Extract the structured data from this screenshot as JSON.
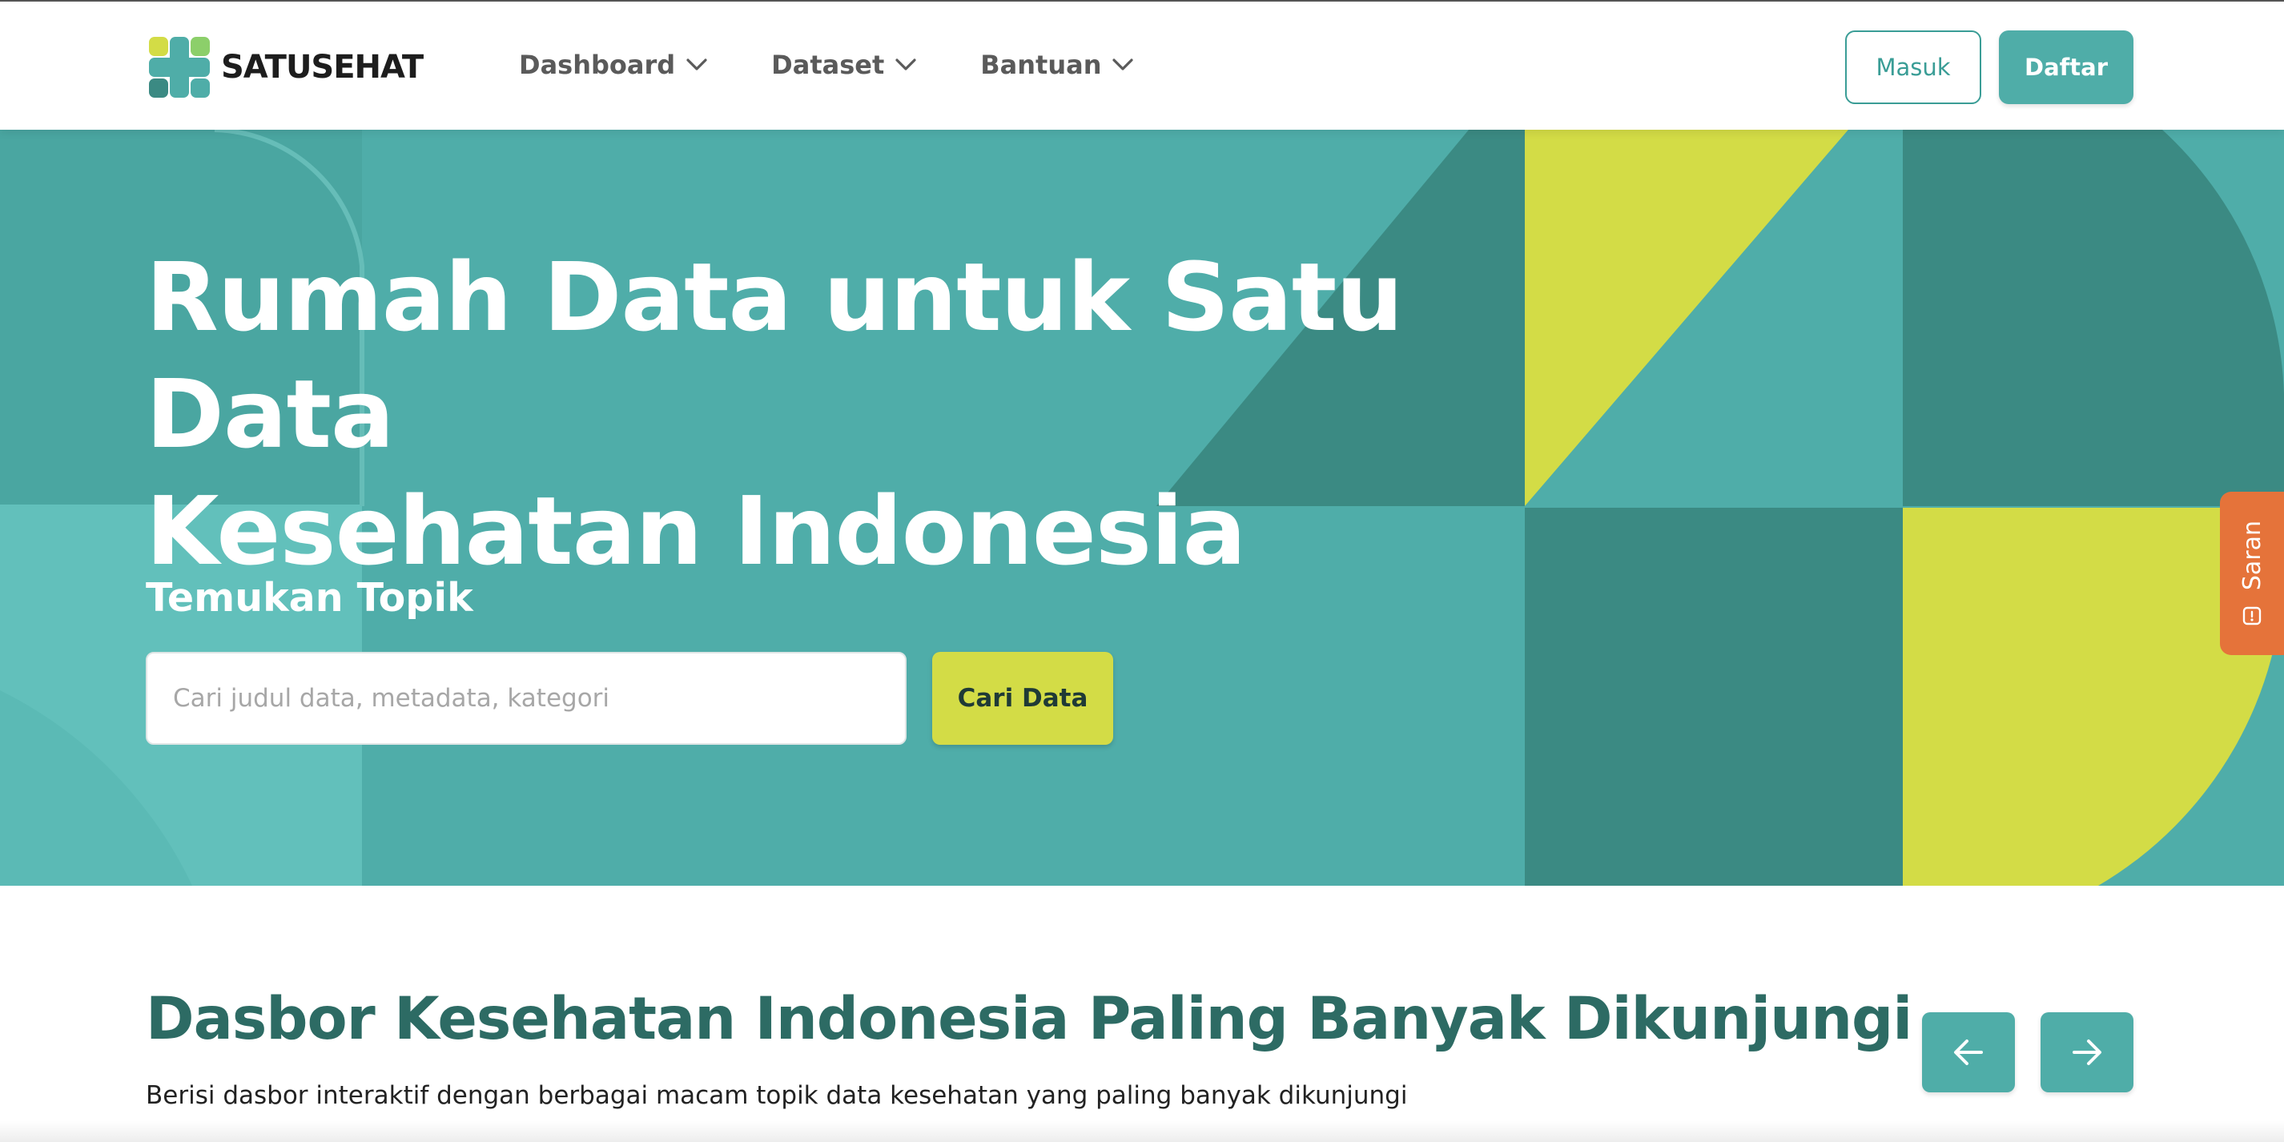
{
  "header": {
    "logo_text": "SATUSEHAT",
    "nav": [
      {
        "label": "Dashboard",
        "icon": "chevron-down-icon"
      },
      {
        "label": "Dataset",
        "icon": "chevron-down-icon"
      },
      {
        "label": "Bantuan",
        "icon": "chevron-down-icon"
      }
    ],
    "login_label": "Masuk",
    "register_label": "Daftar"
  },
  "hero": {
    "title_line1": "Rumah Data untuk Satu Data",
    "title_line2": "Kesehatan Indonesia",
    "subtitle": "Temukan Topik",
    "search_placeholder": "Cari judul data, metadata, kategori",
    "search_value": "",
    "search_button": "Cari Data"
  },
  "feedback_tab": {
    "label": "Saran",
    "icon": "feedback-icon"
  },
  "section": {
    "title": "Dasbor Kesehatan Indonesia Paling Banyak Dikunjungi",
    "description": "Berisi dasbor interaktif dengan berbagai macam topik data kesehatan yang paling banyak dikunjungi",
    "prev_icon": "arrow-left-icon",
    "next_icon": "arrow-right-icon"
  },
  "colors": {
    "brand_teal": "#4fada8",
    "dark_teal": "#3b8a83",
    "lime": "#d3dc46",
    "orange": "#e5733a",
    "heading_green": "#2d6b64"
  }
}
